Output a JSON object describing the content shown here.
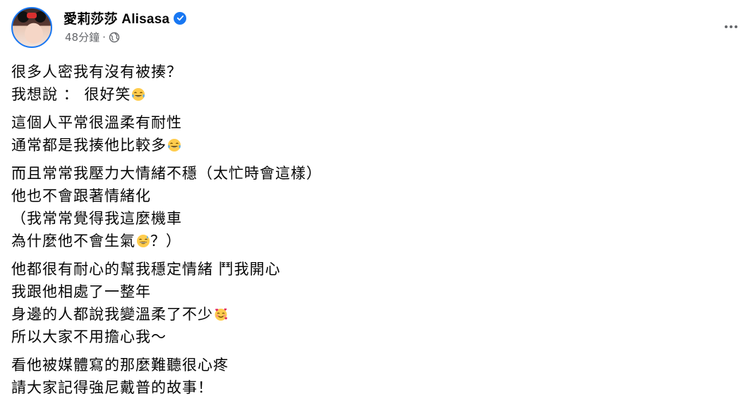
{
  "post": {
    "author": {
      "name": "愛莉莎莎 Alisasa",
      "verified": true,
      "avatar_icon": "profile-photo"
    },
    "timestamp": "48分鐘",
    "separator": "·",
    "audience_icon": "globe-icon",
    "more_icon": "more-horizontal-icon"
  },
  "body": {
    "paragraphs": [
      {
        "lines": [
          {
            "text": "很多人密我有沒有被揍？",
            "emoji": null
          },
          {
            "text": "我想說 ： 很好笑",
            "emoji": "tears-of-joy"
          }
        ]
      },
      {
        "lines": [
          {
            "text": "這個人平常很溫柔有耐性",
            "emoji": null
          },
          {
            "text": "通常都是我揍他比較多",
            "emoji": "tears-of-joy"
          }
        ]
      },
      {
        "lines": [
          {
            "text": "而且常常我壓力大情緒不穩（太忙時會這樣）",
            "emoji": null
          },
          {
            "text": "他也不會跟著情緒化",
            "emoji": null
          },
          {
            "text": "（我常常覺得我這麼機車",
            "emoji": null
          },
          {
            "text": "為什麼他不會生氣",
            "emoji": "grinning-sweat",
            "after": "？）"
          }
        ]
      },
      {
        "lines": [
          {
            "text": "他都很有耐心的幫我穩定情緒 鬥我開心",
            "emoji": null
          },
          {
            "text": "我跟他相處了一整年",
            "emoji": null
          },
          {
            "text": "身邊的人都說我變溫柔了不少",
            "emoji": "smiling-with-hearts"
          },
          {
            "text": "所以大家不用擔心我～",
            "emoji": null
          }
        ]
      },
      {
        "lines": [
          {
            "text": "看他被媒體寫的那麼難聽很心疼",
            "emoji": null
          },
          {
            "text": "請大家記得強尼戴普的故事！",
            "emoji": null
          }
        ]
      }
    ]
  },
  "colors": {
    "text": "#050505",
    "secondary_text": "#65676b",
    "verified_blue": "#1877f2",
    "emoji_yellow": "#ffcc4d",
    "emoji_tear": "#5dadec"
  }
}
